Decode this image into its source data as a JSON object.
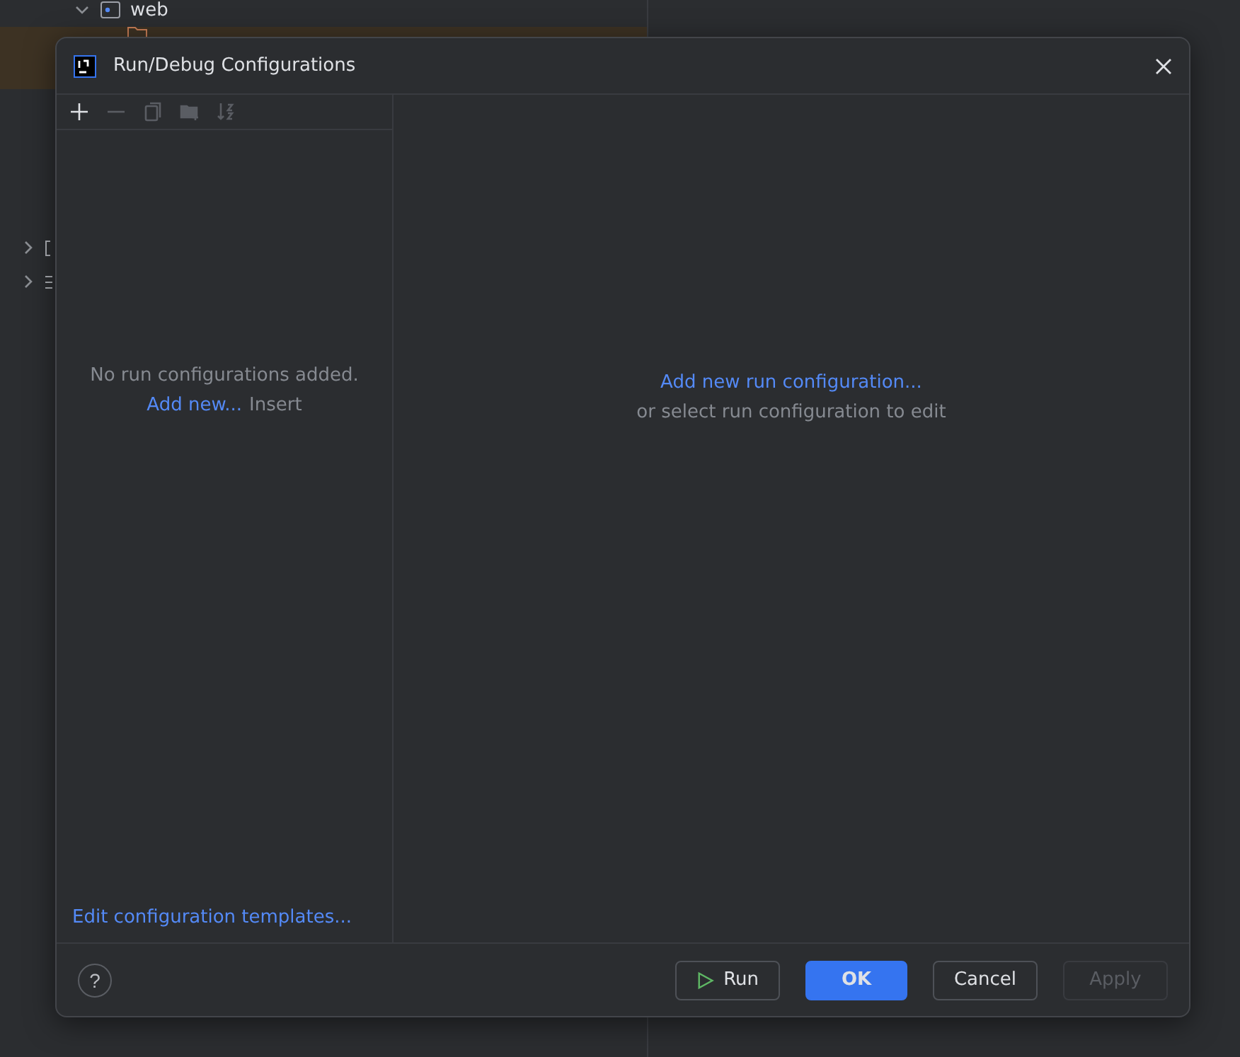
{
  "project_tree": [
    {
      "label": "web",
      "kind": "module",
      "expanded": true,
      "selected": false,
      "children": [
        {
          "kind": "folder",
          "selected": true
        }
      ]
    },
    {
      "kind": "bracket",
      "expanded": false,
      "selected": false
    },
    {
      "kind": "lines",
      "expanded": false,
      "selected": false
    }
  ],
  "dialog": {
    "title": "Run/Debug Configurations",
    "toolbar": [
      {
        "kind": "add",
        "disabled": false
      },
      {
        "kind": "remove",
        "disabled": true
      },
      {
        "kind": "copy",
        "disabled": true
      },
      {
        "kind": "folder",
        "disabled": true
      },
      {
        "kind": "sort",
        "disabled": true
      }
    ],
    "empty_message": "No run configurations added.",
    "add_link": "Add new...",
    "add_shortcut": "Insert",
    "templates_link": "Edit configuration templates...",
    "main_link": "Add new run configuration...",
    "main_hint": "or select run configuration to edit",
    "help": "?",
    "buttons": [
      {
        "label": "Run",
        "kind": "run",
        "disabled": false
      },
      {
        "label": "OK",
        "kind": "primary",
        "disabled": false
      },
      {
        "label": "Cancel",
        "kind": "plain",
        "disabled": false
      },
      {
        "label": "Apply",
        "kind": "plain",
        "disabled": true
      }
    ]
  }
}
